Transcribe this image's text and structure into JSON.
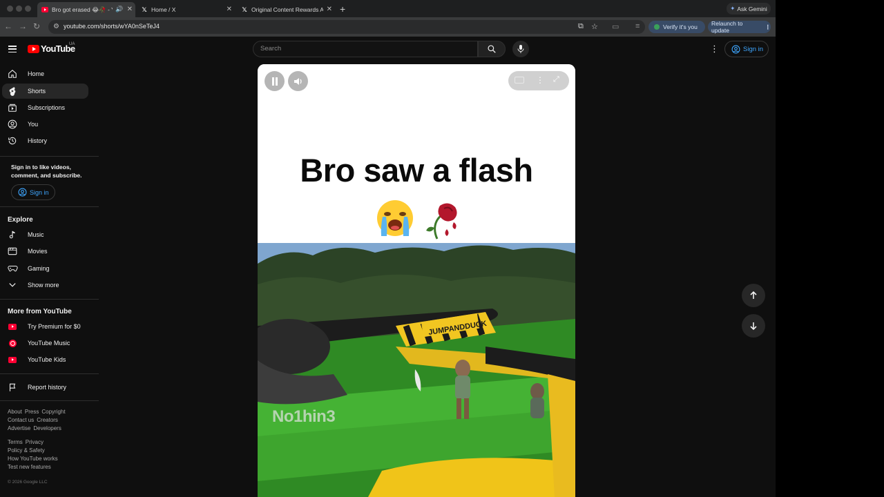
{
  "browser": {
    "tabs": [
      {
        "title": "Bro got erased 😂🥀 - Yo",
        "active": true
      },
      {
        "title": "Home / X",
        "active": false
      },
      {
        "title": "Original Content Rewards Ap",
        "active": false
      }
    ],
    "ask_gemini": "Ask Gemini",
    "url": "youtube.com/shorts/wYA0nSeTeJ4",
    "verify_label": "Verify it's you",
    "relaunch_label": "Relaunch to update"
  },
  "masthead": {
    "logo_text": "YouTube",
    "country_code": "UA",
    "search_placeholder": "Search",
    "signin_label": "Sign in"
  },
  "sidebar": {
    "main": [
      {
        "label": "Home",
        "icon": "home-icon"
      },
      {
        "label": "Shorts",
        "icon": "shorts-icon",
        "active": true
      },
      {
        "label": "Subscriptions",
        "icon": "subscriptions-icon"
      },
      {
        "label": "You",
        "icon": "you-icon"
      },
      {
        "label": "History",
        "icon": "history-icon"
      }
    ],
    "signin_prompt": "Sign in to like videos, comment, and subscribe.",
    "signin_label": "Sign in",
    "explore_title": "Explore",
    "explore": [
      {
        "label": "Music",
        "icon": "music-note-icon"
      },
      {
        "label": "Movies",
        "icon": "movies-icon"
      },
      {
        "label": "Gaming",
        "icon": "gaming-icon"
      },
      {
        "label": "Show more",
        "icon": "chevron-down-icon"
      }
    ],
    "more_title": "More from YouTube",
    "more": [
      {
        "label": "Try Premium for $0",
        "icon": "youtube-premium-icon"
      },
      {
        "label": "YouTube Music",
        "icon": "youtube-music-icon"
      },
      {
        "label": "YouTube Kids",
        "icon": "youtube-kids-icon"
      }
    ],
    "report": {
      "label": "Report history",
      "icon": "flag-icon"
    },
    "footer1": [
      "About",
      "Press",
      "Copyright"
    ],
    "footer2": [
      "Contact us",
      "Creators"
    ],
    "footer3": [
      "Advertise",
      "Developers"
    ],
    "footer4": [
      "Terms",
      "Privacy"
    ],
    "footer5": [
      "Policy & Safety"
    ],
    "footer6": [
      "How YouTube works"
    ],
    "footer7": [
      "Test new features"
    ],
    "copyright": "© 2026 Google LLC"
  },
  "short": {
    "caption": "Bro saw a flash",
    "emojis": "😭🥀",
    "sign_text": "JUMPANDDUCK",
    "watermark": "No1hin3"
  },
  "colors": {
    "accent_link": "#3ea6ff",
    "youtube_red": "#ff0000"
  }
}
